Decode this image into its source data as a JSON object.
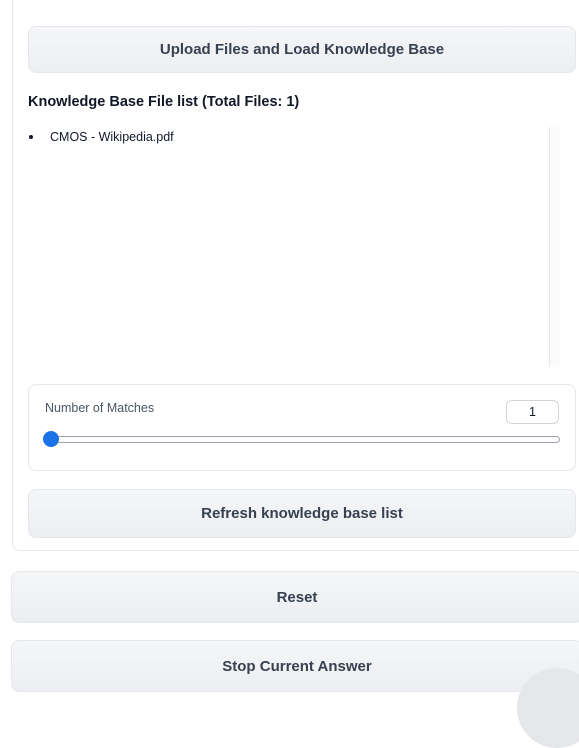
{
  "upload": {
    "label": "Upload Files and Load Knowledge Base"
  },
  "knowledge_base": {
    "title": "Knowledge Base File list (Total Files: 1)",
    "files": [
      "CMOS - Wikipedia.pdf"
    ]
  },
  "matches": {
    "label": "Number of Matches",
    "value": "1",
    "slider_fraction": 0
  },
  "refresh": {
    "label": "Refresh knowledge base list"
  },
  "reset": {
    "label": "Reset"
  },
  "stop": {
    "label": "Stop Current Answer"
  },
  "colors": {
    "accent": "#1a73e8",
    "button_bg": "#eceef1",
    "border": "#e5e7eb"
  }
}
